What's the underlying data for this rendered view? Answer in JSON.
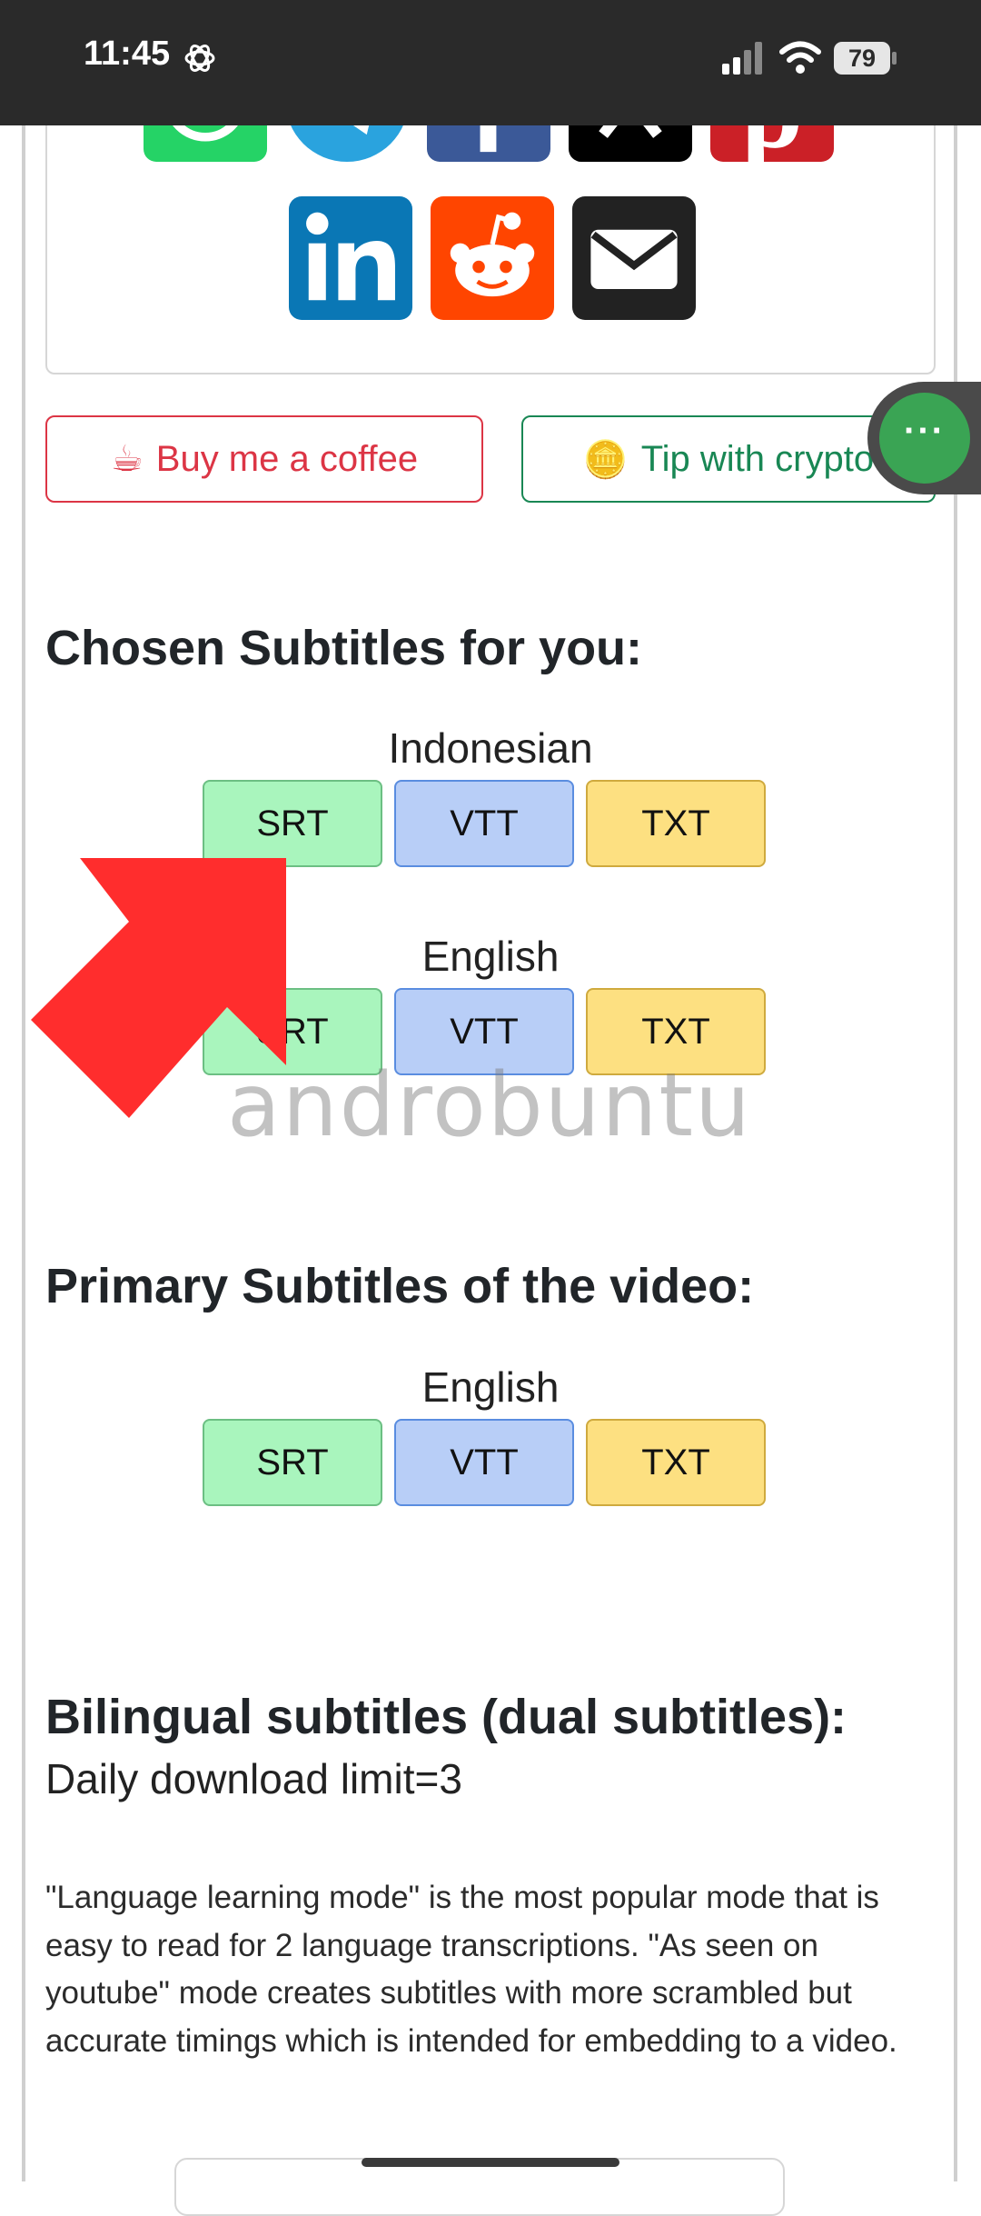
{
  "status_bar": {
    "time": "11:45",
    "battery": "79"
  },
  "share": {
    "row1": [
      "whatsapp-icon",
      "telegram-icon",
      "facebook-icon",
      "x-icon",
      "pinterest-icon"
    ],
    "row2": [
      "linkedin-icon",
      "reddit-icon",
      "email-icon"
    ]
  },
  "support": {
    "coffee_icon": "☕",
    "coffee_label": "Buy me a coffee",
    "crypto_icon": "🪙",
    "crypto_label": "Tip with crypto"
  },
  "floating": {
    "label": "···"
  },
  "chosen": {
    "title": "Chosen Subtitles for you:",
    "groups": [
      {
        "language": "Indonesian",
        "srt": "SRT",
        "vtt": "VTT",
        "txt": "TXT"
      },
      {
        "language": "English",
        "srt": "SRT",
        "vtt": "VTT",
        "txt": "TXT"
      }
    ]
  },
  "primary": {
    "title": "Primary Subtitles of the video:",
    "groups": [
      {
        "language": "English",
        "srt": "SRT",
        "vtt": "VTT",
        "txt": "TXT"
      }
    ]
  },
  "bilingual": {
    "title": "Bilingual subtitles (dual subtitles):",
    "limit": "Daily download limit=3",
    "description": "\"Language learning mode\" is the most popular mode that is easy to read for 2 language transcriptions. \"As seen on youtube\" mode creates subtitles with more scrambled but accurate timings which is intended for embedding to a video."
  },
  "watermark": "androbuntu",
  "colors": {
    "whatsapp": "#25d366",
    "telegram": "#2aa3de",
    "facebook": "#3b5998",
    "x": "#000000",
    "pinterest": "#cb2027",
    "linkedin": "#0a77b5",
    "reddit": "#ff4500",
    "email": "#222222",
    "arrow": "#ff2d2d"
  }
}
